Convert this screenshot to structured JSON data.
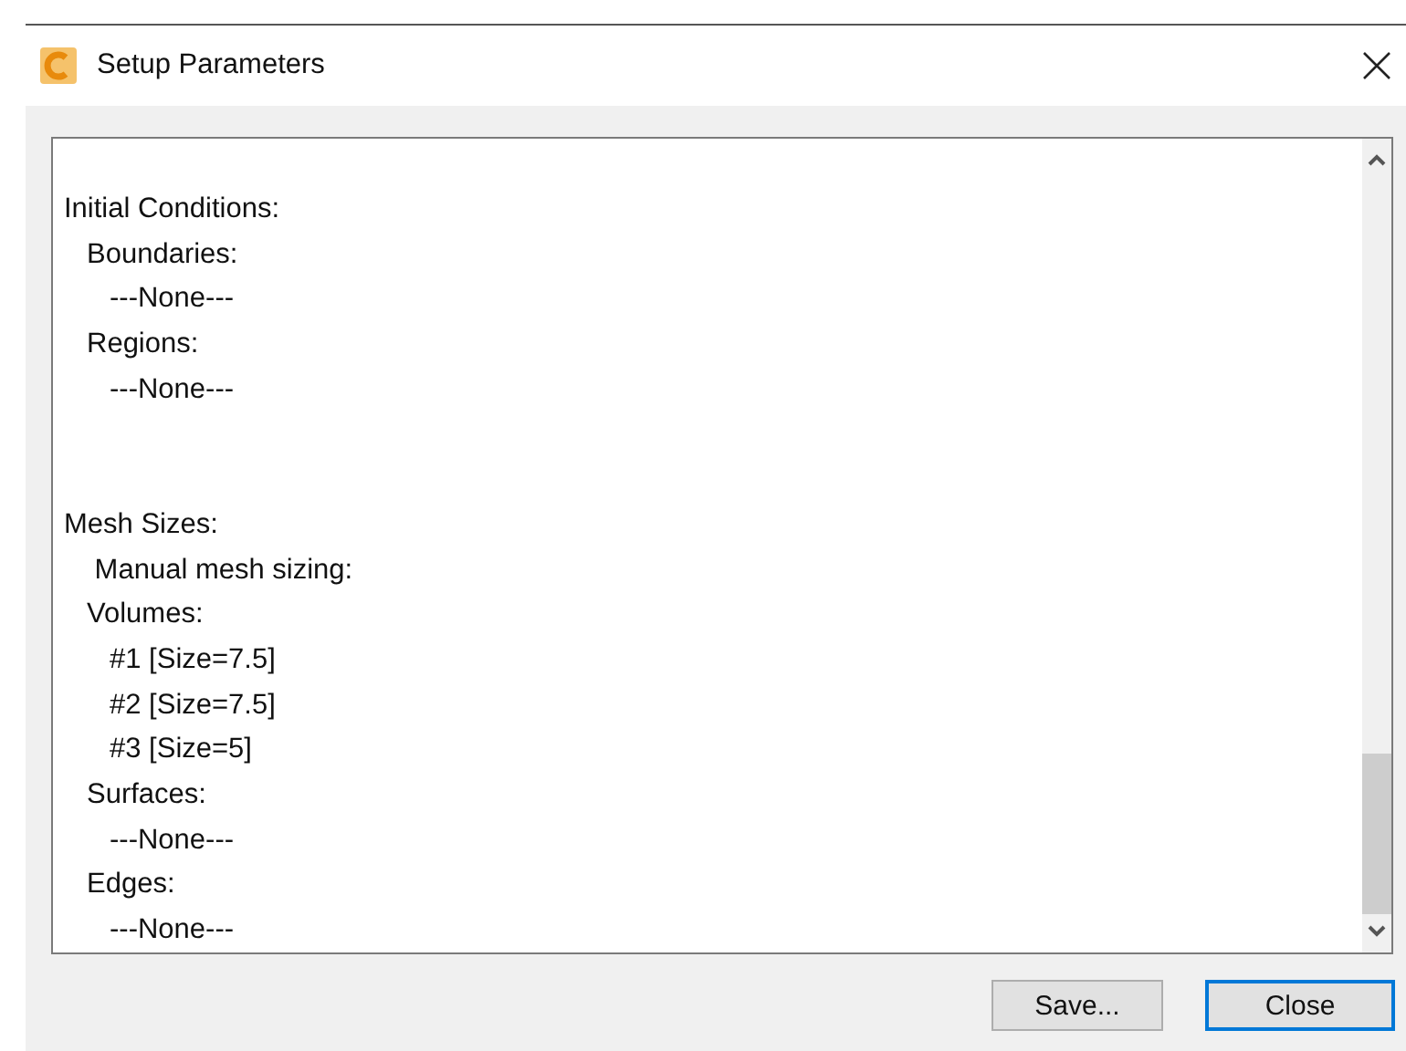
{
  "window": {
    "title": "Setup Parameters"
  },
  "content": [
    {
      "text": "Initial Conditions:",
      "children": [
        {
          "text": "Boundaries:",
          "children": [
            {
              "text": "---None---"
            }
          ]
        },
        {
          "text": "Regions:",
          "children": [
            {
              "text": "---None---"
            }
          ]
        }
      ]
    },
    {
      "text": "Mesh Sizes:",
      "children": [
        {
          "text": " Manual mesh sizing:"
        },
        {
          "text": "Volumes:",
          "children": [
            {
              "text": "#1 [Size=7.5]"
            },
            {
              "text": "#2 [Size=7.5]"
            },
            {
              "text": "#3 [Size=5]"
            }
          ]
        },
        {
          "text": "Surfaces:",
          "children": [
            {
              "text": "---None---"
            }
          ]
        },
        {
          "text": "Edges:",
          "children": [
            {
              "text": "---None---"
            }
          ]
        }
      ]
    }
  ],
  "buttons": [
    {
      "label": "Save...",
      "selected": false
    },
    {
      "label": "Close",
      "selected": true
    }
  ]
}
